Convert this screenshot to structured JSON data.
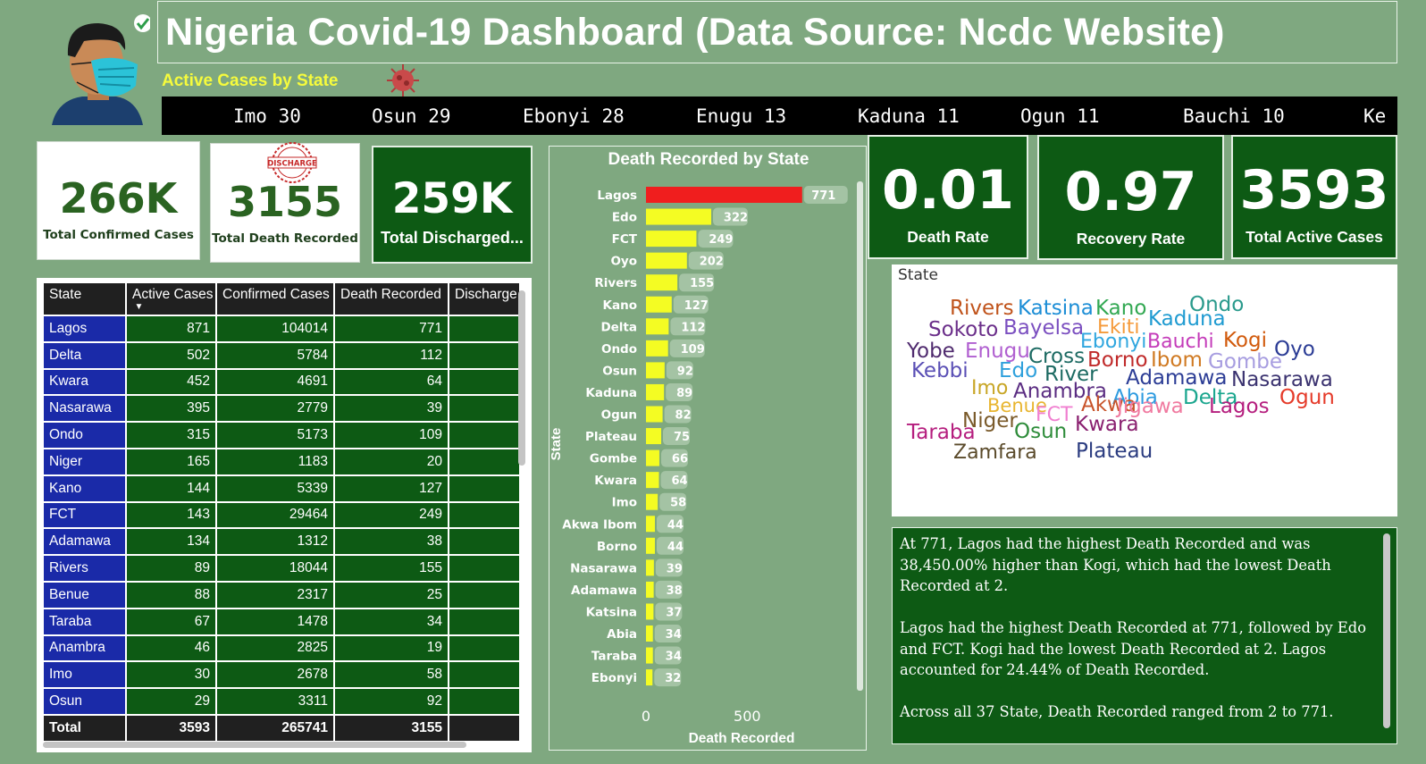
{
  "header": {
    "title": "Nigeria Covid-19 Dashboard (Data Source: Ncdc Website)",
    "ticker_label": "Active Cases by State",
    "ticker_items": [
      "Imo 30",
      "Osun 29",
      "Ebonyi 28",
      "Enugu 13",
      "Kaduna 11",
      "Ogun 11",
      "Bauchi 10",
      "Ke"
    ]
  },
  "icons": {
    "avatar": "masked-person-icon",
    "check": "check-icon",
    "virus": "coronavirus-icon",
    "stamp": "discharge-stamp-icon"
  },
  "stamp_text": "DISCHARGE",
  "kpis": {
    "confirmed": {
      "value": "266K",
      "label": "Total Confirmed Cases"
    },
    "deaths": {
      "value": "3155",
      "label": "Total Death Recorded"
    },
    "discharged": {
      "value": "259K",
      "label": "Total Discharged..."
    },
    "death_rate": {
      "value": "0.01",
      "label": "Death Rate"
    },
    "recovery_rate": {
      "value": "0.97",
      "label": "Recovery Rate"
    },
    "active": {
      "value": "3593",
      "label": "Total Active Cases"
    }
  },
  "table": {
    "columns": [
      "State",
      "Active Cases",
      "Confirmed Cases",
      "Death Recorded",
      "Discharge"
    ],
    "rows": [
      [
        "Lagos",
        "871",
        "104014",
        "771"
      ],
      [
        "Delta",
        "502",
        "5784",
        "112"
      ],
      [
        "Kwara",
        "452",
        "4691",
        "64"
      ],
      [
        "Nasarawa",
        "395",
        "2779",
        "39"
      ],
      [
        "Ondo",
        "315",
        "5173",
        "109"
      ],
      [
        "Niger",
        "165",
        "1183",
        "20"
      ],
      [
        "Kano",
        "144",
        "5339",
        "127"
      ],
      [
        "FCT",
        "143",
        "29464",
        "249"
      ],
      [
        "Adamawa",
        "134",
        "1312",
        "38"
      ],
      [
        "Rivers",
        "89",
        "18044",
        "155"
      ],
      [
        "Benue",
        "88",
        "2317",
        "25"
      ],
      [
        "Taraba",
        "67",
        "1478",
        "34"
      ],
      [
        "Anambra",
        "46",
        "2825",
        "19"
      ],
      [
        "Imo",
        "30",
        "2678",
        "58"
      ],
      [
        "Osun",
        "29",
        "3311",
        "92"
      ]
    ],
    "total": [
      "Total",
      "3593",
      "265741",
      "3155"
    ]
  },
  "chart_data": {
    "type": "bar",
    "orientation": "horizontal",
    "title": "Death Recorded by State",
    "xlabel": "Death Recorded",
    "ylabel": "State",
    "categories": [
      "Lagos",
      "Edo",
      "FCT",
      "Oyo",
      "Rivers",
      "Kano",
      "Delta",
      "Ondo",
      "Osun",
      "Kaduna",
      "Ogun",
      "Plateau",
      "Gombe",
      "Kwara",
      "Imo",
      "Akwa Ibom",
      "Borno",
      "Nasarawa",
      "Adamawa",
      "Katsina",
      "Abia",
      "Taraba",
      "Ebonyi"
    ],
    "values": [
      771,
      322,
      249,
      202,
      155,
      127,
      112,
      109,
      92,
      89,
      82,
      75,
      66,
      64,
      58,
      44,
      44,
      39,
      38,
      37,
      34,
      34,
      32
    ],
    "x_ticks": [
      "0",
      "500"
    ],
    "xlim": [
      0,
      900
    ],
    "highlight_category": "Lagos",
    "bar_color": "#f4fc23",
    "highlight_color": "#f01e1e",
    "grid": false
  },
  "wordcloud": {
    "title": "State",
    "words": [
      {
        "text": "Rivers",
        "color": "#c0531b"
      },
      {
        "text": "Katsina",
        "color": "#1d8ed6"
      },
      {
        "text": "Kano",
        "color": "#32a852"
      },
      {
        "text": "Ondo",
        "color": "#2a9a8c"
      },
      {
        "text": "Sokoto",
        "color": "#6b2f8a"
      },
      {
        "text": "Bayelsa",
        "color": "#7b4fc0"
      },
      {
        "text": "Ekiti",
        "color": "#f59a3a"
      },
      {
        "text": "Kaduna",
        "color": "#1f9bd1"
      },
      {
        "text": "Ebonyi",
        "color": "#2fa6df"
      },
      {
        "text": "Bauchi",
        "color": "#c43bb9"
      },
      {
        "text": "Kogi",
        "color": "#d15a0c"
      },
      {
        "text": "Oyo",
        "color": "#2b3c95"
      },
      {
        "text": "Yobe",
        "color": "#4f2a6e"
      },
      {
        "text": "Enugu",
        "color": "#b05fd0"
      },
      {
        "text": "Cross",
        "color": "#1c6a62"
      },
      {
        "text": "Borno",
        "color": "#c02a2a"
      },
      {
        "text": "Ibom",
        "color": "#d07a22"
      },
      {
        "text": "Gombe",
        "color": "#a79de0"
      },
      {
        "text": "Kebbi",
        "color": "#5a4fb5"
      },
      {
        "text": "Edo",
        "color": "#2ea0dc"
      },
      {
        "text": "River",
        "color": "#1c6a62"
      },
      {
        "text": "Adamawa",
        "color": "#2b3c95"
      },
      {
        "text": "Nasarawa",
        "color": "#3b3370"
      },
      {
        "text": "Imo",
        "color": "#c8a626"
      },
      {
        "text": "Anambra",
        "color": "#5b2d82"
      },
      {
        "text": "Abia",
        "color": "#2e9be0"
      },
      {
        "text": "Delta",
        "color": "#1aa68e"
      },
      {
        "text": "Ogun",
        "color": "#e53b2a"
      },
      {
        "text": "Benue",
        "color": "#e8b52f"
      },
      {
        "text": "Niger",
        "color": "#7a5a2a"
      },
      {
        "text": "FCT",
        "color": "#f07fd0"
      },
      {
        "text": "Akwa",
        "color": "#c8532a"
      },
      {
        "text": "Jigawa",
        "color": "#f07aa0"
      },
      {
        "text": "Lagos",
        "color": "#b51e7e"
      },
      {
        "text": "Taraba",
        "color": "#b51e7e"
      },
      {
        "text": "Osun",
        "color": "#2e8c3a"
      },
      {
        "text": "Kwara",
        "color": "#8a2170"
      },
      {
        "text": "Zamfara",
        "color": "#5a4a2a"
      },
      {
        "text": "Plateau",
        "color": "#2b3c80"
      }
    ]
  },
  "narrative": [
    "At 771, Lagos had the highest Death Recorded and was 38,450.00% higher than Kogi, which had the lowest Death Recorded at 2.",
    "Lagos had the highest Death Recorded at 771, followed by Edo and FCT. Kogi had the lowest Death Recorded at 2. Lagos accounted for 24.44% of Death Recorded.",
    "Across all 37 State, Death Recorded ranged from 2 to 771."
  ]
}
